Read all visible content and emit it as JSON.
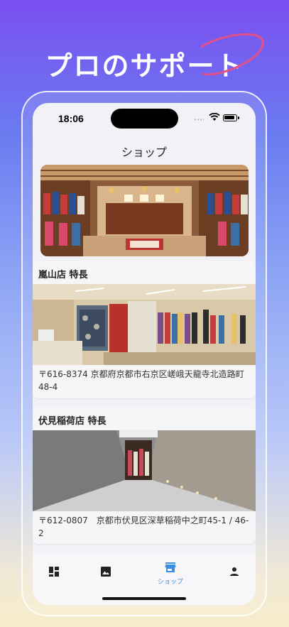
{
  "promo": {
    "headline": "プロのサポート"
  },
  "status_bar": {
    "time": "18:06"
  },
  "nav": {
    "title": "ショップ"
  },
  "shops": [
    {
      "title": "嵐山店 特長",
      "address": "〒616-8374 京都府京都市右京区嵯峨天龍寺北造路町48-4"
    },
    {
      "title": "伏見稲荷店 特長",
      "address": "〒612-0807　京都市伏見区深草稲荷中之町45-1 / 46-2"
    }
  ],
  "tabbar": {
    "tabs": [
      {
        "icon": "dashboard-icon",
        "label": ""
      },
      {
        "icon": "image-icon",
        "label": ""
      },
      {
        "icon": "store-icon",
        "label": "ショップ",
        "active": true
      },
      {
        "icon": "person-icon",
        "label": ""
      }
    ]
  },
  "colors": {
    "accent": "#3d8fe0",
    "screen_bg": "#f2f2f6",
    "swoosh": "#e0508a"
  }
}
